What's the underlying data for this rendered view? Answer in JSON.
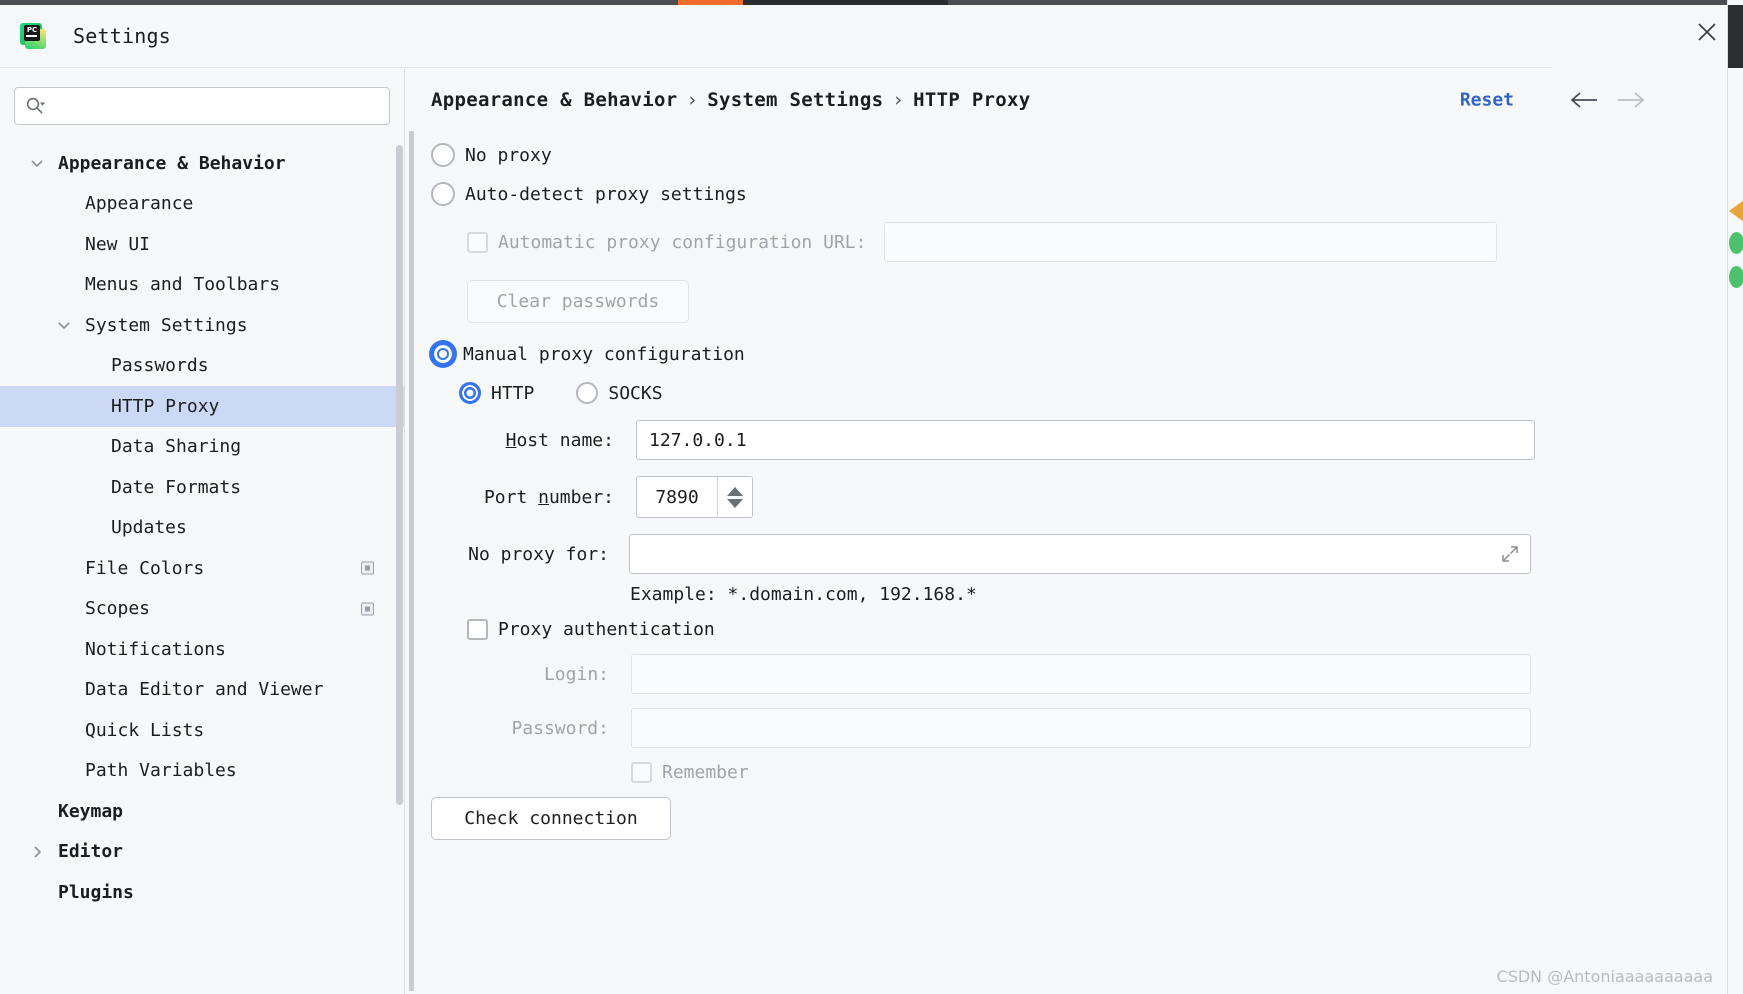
{
  "window": {
    "title": "Settings",
    "app_icon": "pycharm-icon",
    "close_icon": "close-icon"
  },
  "sidebar": {
    "search": {
      "placeholder": "",
      "value": "",
      "icon": "search-icon"
    },
    "items": [
      {
        "label": "Appearance & Behavior",
        "level": 0,
        "bold": true,
        "arrow": "chevron-down",
        "selected": false
      },
      {
        "label": "Appearance",
        "level": 1,
        "bold": false,
        "arrow": "",
        "selected": false
      },
      {
        "label": "New UI",
        "level": 1,
        "bold": false,
        "arrow": "",
        "selected": false
      },
      {
        "label": "Menus and Toolbars",
        "level": 1,
        "bold": false,
        "arrow": "",
        "selected": false
      },
      {
        "label": "System Settings",
        "level": 1,
        "bold": false,
        "arrow": "chevron-down",
        "selected": false
      },
      {
        "label": "Passwords",
        "level": 2,
        "bold": false,
        "arrow": "",
        "selected": false
      },
      {
        "label": "HTTP Proxy",
        "level": 2,
        "bold": false,
        "arrow": "",
        "selected": true
      },
      {
        "label": "Data Sharing",
        "level": 2,
        "bold": false,
        "arrow": "",
        "selected": false
      },
      {
        "label": "Date Formats",
        "level": 2,
        "bold": false,
        "arrow": "",
        "selected": false
      },
      {
        "label": "Updates",
        "level": 2,
        "bold": false,
        "arrow": "",
        "selected": false
      },
      {
        "label": "File Colors",
        "level": 1,
        "bold": false,
        "arrow": "",
        "selected": false,
        "badge": true
      },
      {
        "label": "Scopes",
        "level": 1,
        "bold": false,
        "arrow": "",
        "selected": false,
        "badge": true
      },
      {
        "label": "Notifications",
        "level": 1,
        "bold": false,
        "arrow": "",
        "selected": false
      },
      {
        "label": "Data Editor and Viewer",
        "level": 1,
        "bold": false,
        "arrow": "",
        "selected": false
      },
      {
        "label": "Quick Lists",
        "level": 1,
        "bold": false,
        "arrow": "",
        "selected": false
      },
      {
        "label": "Path Variables",
        "level": 1,
        "bold": false,
        "arrow": "",
        "selected": false
      },
      {
        "label": "Keymap",
        "level": 0,
        "bold": true,
        "arrow": "",
        "selected": false
      },
      {
        "label": "Editor",
        "level": 0,
        "bold": true,
        "arrow": "chevron-right",
        "selected": false
      },
      {
        "label": "Plugins",
        "level": 0,
        "bold": true,
        "arrow": "",
        "selected": false
      }
    ]
  },
  "header": {
    "breadcrumb": [
      "Appearance & Behavior",
      "System Settings",
      "HTTP Proxy"
    ],
    "separator": "›",
    "reset_label": "Reset",
    "back_icon": "arrow-left-icon",
    "forward_icon": "arrow-right-icon"
  },
  "form": {
    "no_proxy": {
      "label": "No proxy",
      "selected": false
    },
    "auto_detect": {
      "label": "Auto-detect proxy settings",
      "selected": false
    },
    "pac_url": {
      "label": "Automatic proxy configuration URL:",
      "checked": false,
      "disabled": true,
      "value": "",
      "placeholder": ""
    },
    "clear_passwords": {
      "label": "Clear passwords",
      "disabled": true
    },
    "manual": {
      "label": "Manual proxy configuration",
      "selected": true
    },
    "protocol": {
      "http": {
        "label": "HTTP",
        "selected": true
      },
      "socks": {
        "label": "SOCKS",
        "selected": false
      }
    },
    "host": {
      "label": "Host name:",
      "mnemonic": "H",
      "value": "127.0.0.1",
      "placeholder": ""
    },
    "port": {
      "label": "Port number:",
      "mnemonic": "n",
      "value": "7890"
    },
    "no_proxy_for": {
      "label": "No proxy for:",
      "value": "",
      "placeholder": "",
      "expand_icon": "expand-icon"
    },
    "example": "Example: *.domain.com, 192.168.*",
    "proxy_auth": {
      "label": "Proxy authentication",
      "checked": false
    },
    "login": {
      "label": "Login:",
      "value": "",
      "placeholder": "",
      "disabled": true
    },
    "password": {
      "label": "Password:",
      "value": "",
      "placeholder": "",
      "disabled": true
    },
    "remember": {
      "label": "Remember",
      "checked": false,
      "disabled": true
    },
    "check_connection": {
      "label": "Check connection"
    }
  },
  "watermark": "CSDN @Antoniaaaaaaaaaa",
  "colors": {
    "accent": "#3574f0",
    "link": "#3063c4",
    "selection": "#ccd9f6",
    "background": "#f7f8fa"
  }
}
